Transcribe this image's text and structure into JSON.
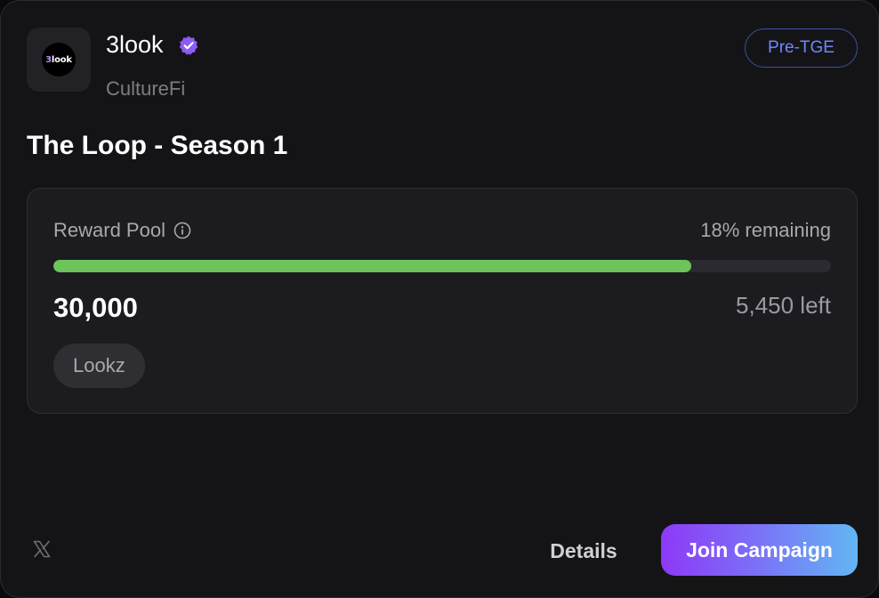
{
  "project": {
    "logo_text_num": "3",
    "logo_text_rest": "look",
    "name": "3look",
    "category": "CultureFi",
    "status_badge": "Pre-TGE"
  },
  "campaign": {
    "title": "The Loop - Season 1"
  },
  "reward_pool": {
    "label": "Reward Pool",
    "remaining_text": "18% remaining",
    "progress_fraction": 0.82,
    "total_amount": "30,000",
    "left_text": "5,450 left",
    "token": "Lookz"
  },
  "footer": {
    "details_label": "Details",
    "join_label": "Join Campaign"
  },
  "colors": {
    "progress_fill": "#6cc45a",
    "badge": "#6e87ff",
    "verified": "#8b5cf6",
    "join_gradient_start": "#8d39f7",
    "join_gradient_end": "#62b6f4"
  },
  "icons": {
    "verified": "verified-badge-icon",
    "info": "info-icon",
    "social": "x-icon"
  }
}
